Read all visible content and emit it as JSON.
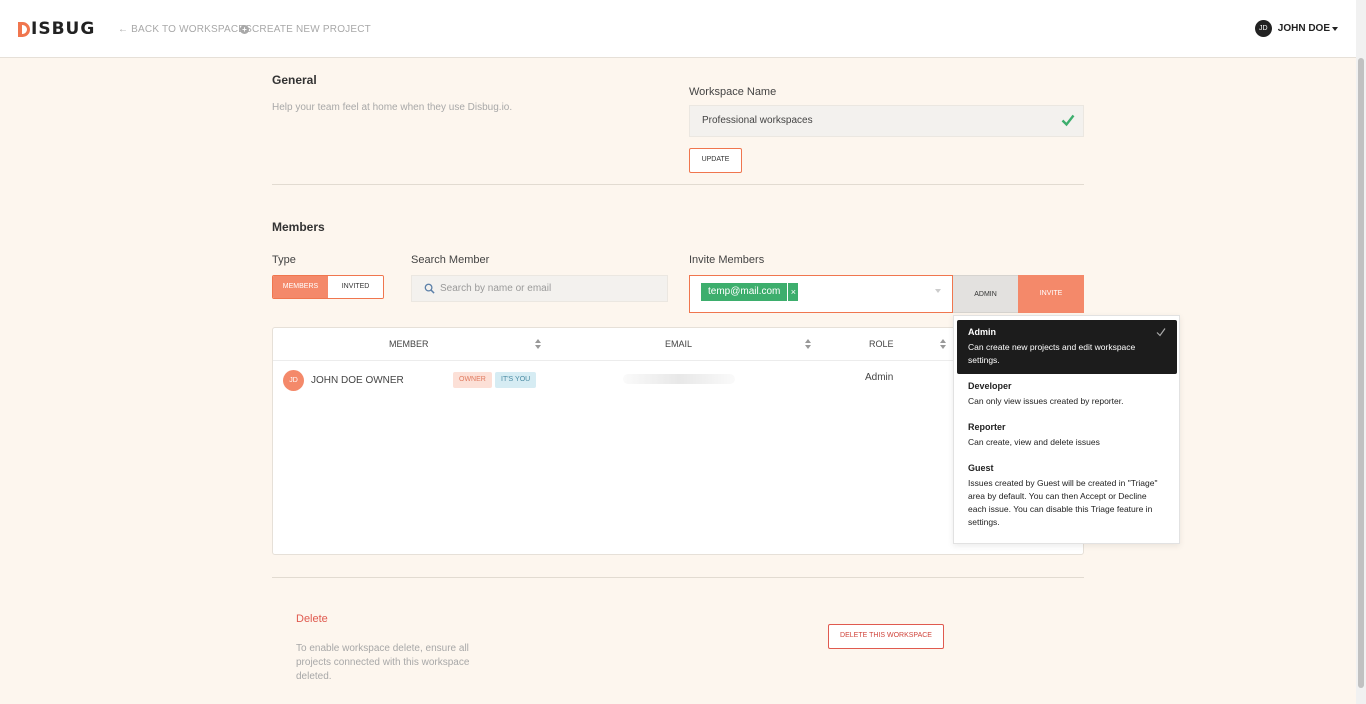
{
  "brand": {
    "logo_text": "ISBUG",
    "accent": "#f0764e"
  },
  "nav": {
    "back_label": "← BACK TO WORKSPACES",
    "create_label": "CREATE NEW PROJECT",
    "user_initials": "JD",
    "user_name": "JOHN DOE"
  },
  "general": {
    "title": "General",
    "description": "Help your team feel at home when they use Disbug.io.",
    "workspace_label": "Workspace Name",
    "workspace_value": "Professional workspaces",
    "update_label": "UPDATE"
  },
  "members": {
    "title": "Members",
    "type_label": "Type",
    "type_options": [
      "MEMBERS",
      "INVITED"
    ],
    "type_selected": "MEMBERS",
    "search_label": "Search Member",
    "search_placeholder": "Search by name or email",
    "invite_label": "Invite Members",
    "invite_tag": "temp@mail.com",
    "invite_tag_remove": "×",
    "role_button": "ADMIN",
    "invite_button": "INVITE"
  },
  "table": {
    "columns": [
      "MEMBER",
      "EMAIL",
      "ROLE"
    ],
    "rows": [
      {
        "initials": "JD",
        "name": "JOHN DOE OWNER",
        "badges": [
          "OWNER",
          "IT'S YOU"
        ],
        "email": "",
        "role": "Admin"
      }
    ]
  },
  "role_dropdown": {
    "options": [
      {
        "title": "Admin",
        "description": "Can create new projects and edit workspace settings.",
        "selected": true
      },
      {
        "title": "Developer",
        "description": "Can only view issues created by reporter.",
        "selected": false
      },
      {
        "title": "Reporter",
        "description": "Can create, view and delete issues",
        "selected": false
      },
      {
        "title": "Guest",
        "description": "Issues created by Guest will be created in \"Triage\" area by default. You can then Accept or Decline each issue. You can disable this Triage feature in settings.",
        "selected": false
      }
    ]
  },
  "delete": {
    "title": "Delete",
    "description": "To enable workspace delete, ensure all projects connected with this workspace deleted.",
    "button_label": "DELETE THIS WORKSPACE"
  }
}
